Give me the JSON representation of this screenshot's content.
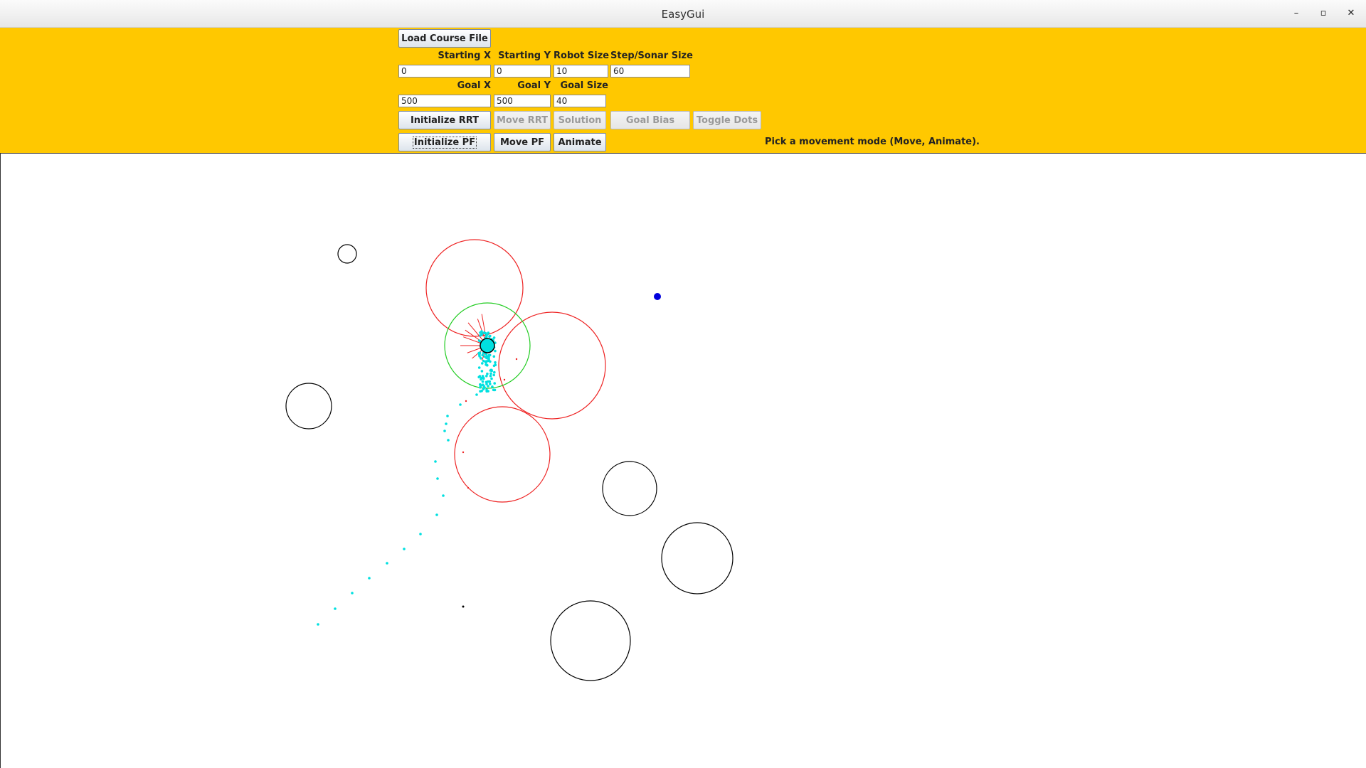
{
  "window": {
    "title": "EasyGui"
  },
  "panel": {
    "load_button": "Load Course File",
    "labels": {
      "starting_x": "Starting X",
      "starting_y": "Starting Y",
      "robot_size": "Robot Size",
      "step_sonar_size": "Step/Sonar Size",
      "goal_x": "Goal X",
      "goal_y": "Goal Y",
      "goal_size": "Goal Size"
    },
    "values": {
      "starting_x": "0",
      "starting_y": "0",
      "robot_size": "10",
      "step_sonar_size": "60",
      "goal_x": "500",
      "goal_y": "500",
      "goal_size": "40"
    },
    "buttons": {
      "initialize_rrt": "Initialize RRT",
      "move_rrt": "Move RRT",
      "solution": "Solution",
      "goal_bias": "Goal Bias",
      "toggle_dots": "Toggle Dots",
      "initialize_pf": "Initialize PF",
      "move_pf": "Move PF",
      "animate": "Animate"
    },
    "status": "Pick a movement mode (Move, Animate)."
  },
  "colors": {
    "panel_bg": "#ffc800",
    "obstacle": "#000000",
    "sensed_obstacle": "#ee2222",
    "sonar_ring": "#22cc22",
    "particles": "#00e0e0",
    "goal": "#0000dd"
  }
}
